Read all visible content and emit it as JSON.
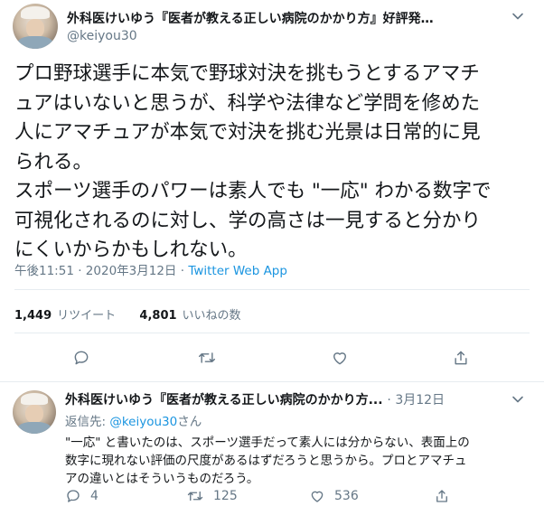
{
  "main_tweet": {
    "author_name": "外科医けいゆう『医者が教える正しい病院のかかり方』好評発…",
    "handle": "@keiyou30",
    "text_lines": [
      "プロ野球選手に本気で野球対決を挑もうとするアマチ",
      "ュアはいないと思うが、科学や法律など学問を修めた",
      "人にアマチュアが本気で対決を挑む光景は日常的に見",
      "られる。",
      "スポーツ選手のパワーは素人でも \"一応\" わかる数字で",
      "可視化されるのに対し、学の高さは一見すると分かり",
      "にくいからかもしれない。"
    ],
    "time": "午後11:51",
    "date": "2020年3月12日",
    "separator": "·",
    "source": "Twitter Web App",
    "retweets_count": "1,449",
    "retweets_label": "リツイート",
    "likes_count": "4,801",
    "likes_label": "いいねの数"
  },
  "reply_tweet": {
    "author_name": "外科医けいゆう『医者が教える正しい病院のかかり方...",
    "date": "· 3月12日",
    "reply_prefix": "返信先: ",
    "reply_to_handle": "@keiyou30",
    "reply_suffix": "さん",
    "text_lines": [
      "\"一応\" と書いたのは、スポーツ選手だって素人には分からない、表面上の",
      "数字に現れない評価の尺度があるはずだろうと思うから。プロとアマチュ",
      "アの違いとはそういうものだろう。"
    ],
    "reply_count": "4",
    "retweet_count": "125",
    "like_count": "536"
  },
  "icons": [
    "chevron-down-icon",
    "reply-icon",
    "retweet-icon",
    "like-icon",
    "share-icon"
  ],
  "colors": {
    "link": "#1b95e0",
    "secondary": "#657786",
    "text": "#14171a",
    "divider": "#e6ecf0"
  }
}
